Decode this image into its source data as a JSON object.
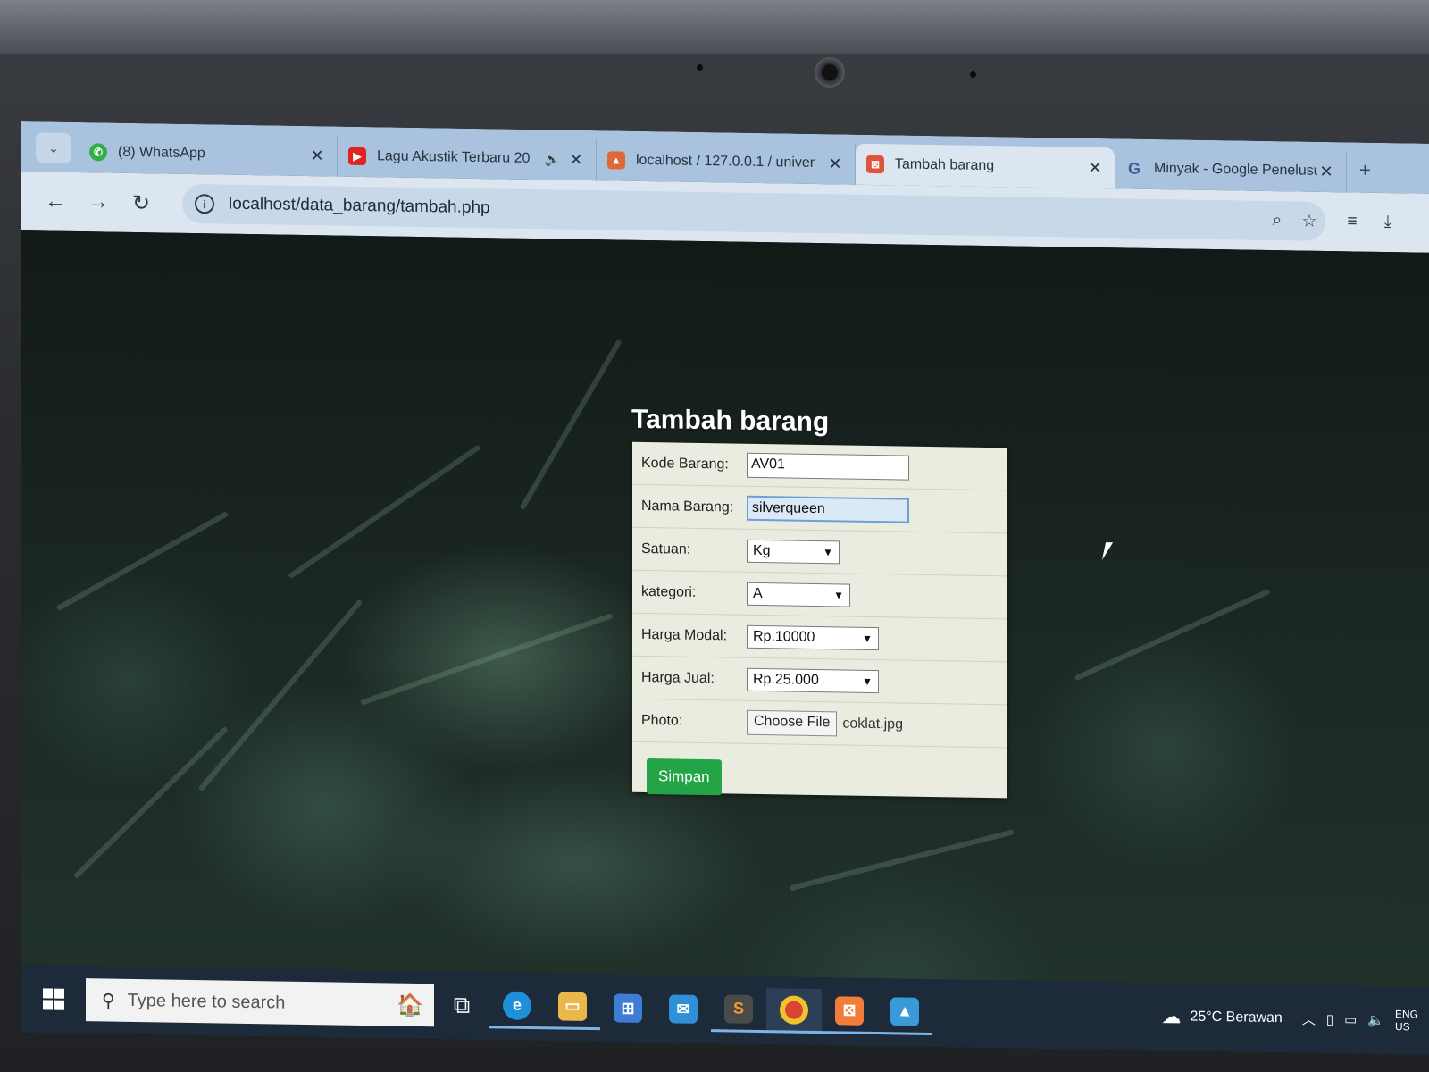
{
  "browser": {
    "tabs": [
      {
        "title": "(8) WhatsApp",
        "icon": "whatsapp-icon",
        "color": "#2fae4a"
      },
      {
        "title": "Lagu Akustik Terbaru 20",
        "icon": "youtube-icon",
        "color": "#e02424"
      },
      {
        "title": "localhost / 127.0.0.1 / univer",
        "icon": "phpmyadmin-icon",
        "color": "#e0673a"
      },
      {
        "title": "Tambah barang",
        "icon": "xampp-icon",
        "color": "#e0523a",
        "active": true
      },
      {
        "title": "Minyak - Google Penelusuran",
        "icon": "google-icon",
        "color": "#4285f4"
      }
    ],
    "url": "localhost/data_barang/tambah.php"
  },
  "form": {
    "title": "Tambah barang",
    "fields": {
      "kode_label": "Kode Barang:",
      "kode_value": "AV01",
      "nama_label": "Nama Barang:",
      "nama_value": "silverqueen",
      "satuan_label": "Satuan:",
      "satuan_value": "Kg",
      "kategori_label": "kategori:",
      "kategori_value": "A",
      "modal_label": "Harga Modal:",
      "modal_value": "Rp.10000",
      "jual_label": "Harga Jual:",
      "jual_value": "Rp.25.000",
      "photo_label": "Photo:",
      "photo_button": "Choose File",
      "photo_file": "coklat.jpg"
    },
    "submit_label": "Simpan",
    "submit_color": "#22a447"
  },
  "taskbar": {
    "search_placeholder": "Type here to search",
    "weather_temp": "25°C",
    "weather_desc": "Berawan",
    "lang_top": "ENG",
    "lang_bottom": "US"
  }
}
